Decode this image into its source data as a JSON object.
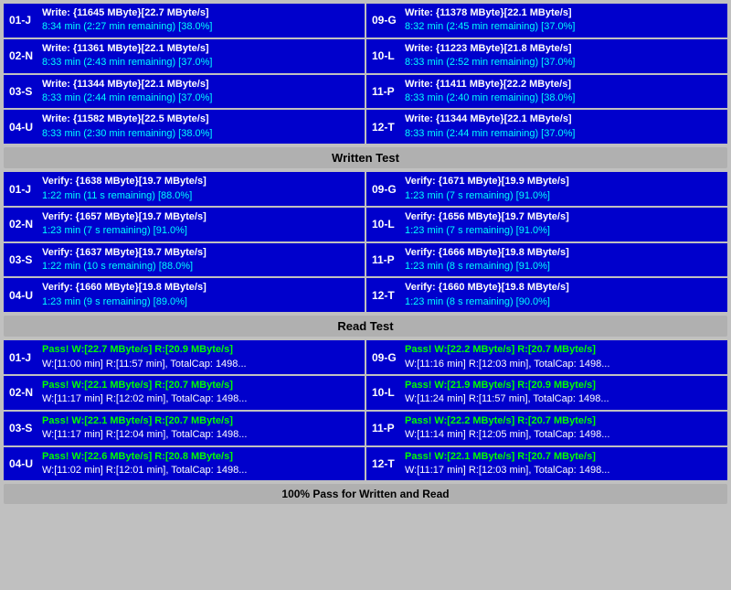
{
  "sections": {
    "written_test": {
      "label": "Written Test",
      "rows_left": [
        {
          "id": "01-J",
          "line1": "Write: {11645 MByte}[22.7 MByte/s]",
          "line2": "8:34 min (2:27 min remaining)  [38.0%]"
        },
        {
          "id": "02-N",
          "line1": "Write: {11361 MByte}[22.1 MByte/s]",
          "line2": "8:33 min (2:43 min remaining)  [37.0%]"
        },
        {
          "id": "03-S",
          "line1": "Write: {11344 MByte}[22.1 MByte/s]",
          "line2": "8:33 min (2:44 min remaining)  [37.0%]"
        },
        {
          "id": "04-U",
          "line1": "Write: {11582 MByte}[22.5 MByte/s]",
          "line2": "8:33 min (2:30 min remaining)  [38.0%]"
        }
      ],
      "rows_right": [
        {
          "id": "09-G",
          "line1": "Write: {11378 MByte}[22.1 MByte/s]",
          "line2": "8:32 min (2:45 min remaining)  [37.0%]"
        },
        {
          "id": "10-L",
          "line1": "Write: {11223 MByte}[21.8 MByte/s]",
          "line2": "8:33 min (2:52 min remaining)  [37.0%]"
        },
        {
          "id": "11-P",
          "line1": "Write: {11411 MByte}[22.2 MByte/s]",
          "line2": "8:33 min (2:40 min remaining)  [38.0%]"
        },
        {
          "id": "12-T",
          "line1": "Write: {11344 MByte}[22.1 MByte/s]",
          "line2": "8:33 min (2:44 min remaining)  [37.0%]"
        }
      ]
    },
    "verify_test": {
      "rows_left": [
        {
          "id": "01-J",
          "line1": "Verify: {1638 MByte}[19.7 MByte/s]",
          "line2": "1:22 min (11 s remaining)  [88.0%]"
        },
        {
          "id": "02-N",
          "line1": "Verify: {1657 MByte}[19.7 MByte/s]",
          "line2": "1:23 min (7 s remaining)  [91.0%]"
        },
        {
          "id": "03-S",
          "line1": "Verify: {1637 MByte}[19.7 MByte/s]",
          "line2": "1:22 min (10 s remaining)  [88.0%]"
        },
        {
          "id": "04-U",
          "line1": "Verify: {1660 MByte}[19.8 MByte/s]",
          "line2": "1:23 min (9 s remaining)  [89.0%]"
        }
      ],
      "rows_right": [
        {
          "id": "09-G",
          "line1": "Verify: {1671 MByte}[19.9 MByte/s]",
          "line2": "1:23 min (7 s remaining)  [91.0%]"
        },
        {
          "id": "10-L",
          "line1": "Verify: {1656 MByte}[19.7 MByte/s]",
          "line2": "1:23 min (7 s remaining)  [91.0%]"
        },
        {
          "id": "11-P",
          "line1": "Verify: {1666 MByte}[19.8 MByte/s]",
          "line2": "1:23 min (8 s remaining)  [91.0%]"
        },
        {
          "id": "12-T",
          "line1": "Verify: {1660 MByte}[19.8 MByte/s]",
          "line2": "1:23 min (8 s remaining)  [90.0%]"
        }
      ]
    },
    "read_test": {
      "label": "Read Test",
      "rows_left": [
        {
          "id": "01-J",
          "line1": "Pass! W:[22.7 MByte/s] R:[20.9 MByte/s]",
          "line2": "W:[11:00 min] R:[11:57 min], TotalCap: 1498..."
        },
        {
          "id": "02-N",
          "line1": "Pass! W:[22.1 MByte/s] R:[20.7 MByte/s]",
          "line2": "W:[11:17 min] R:[12:02 min], TotalCap: 1498..."
        },
        {
          "id": "03-S",
          "line1": "Pass! W:[22.1 MByte/s] R:[20.7 MByte/s]",
          "line2": "W:[11:17 min] R:[12:04 min], TotalCap: 1498..."
        },
        {
          "id": "04-U",
          "line1": "Pass! W:[22.6 MByte/s] R:[20.8 MByte/s]",
          "line2": "W:[11:02 min] R:[12:01 min], TotalCap: 1498..."
        }
      ],
      "rows_right": [
        {
          "id": "09-G",
          "line1": "Pass! W:[22.2 MByte/s] R:[20.7 MByte/s]",
          "line2": "W:[11:16 min] R:[12:03 min], TotalCap: 1498..."
        },
        {
          "id": "10-L",
          "line1": "Pass! W:[21.9 MByte/s] R:[20.9 MByte/s]",
          "line2": "W:[11:24 min] R:[11:57 min], TotalCap: 1498..."
        },
        {
          "id": "11-P",
          "line1": "Pass! W:[22.2 MByte/s] R:[20.7 MByte/s]",
          "line2": "W:[11:14 min] R:[12:05 min], TotalCap: 1498..."
        },
        {
          "id": "12-T",
          "line1": "Pass! W:[22.1 MByte/s] R:[20.7 MByte/s]",
          "line2": "W:[11:17 min] R:[12:03 min], TotalCap: 1498..."
        }
      ]
    }
  },
  "labels": {
    "written_test_header": "Written Test",
    "read_test_header": "Read Test",
    "bottom_status": "100% Pass for Written and Read"
  }
}
